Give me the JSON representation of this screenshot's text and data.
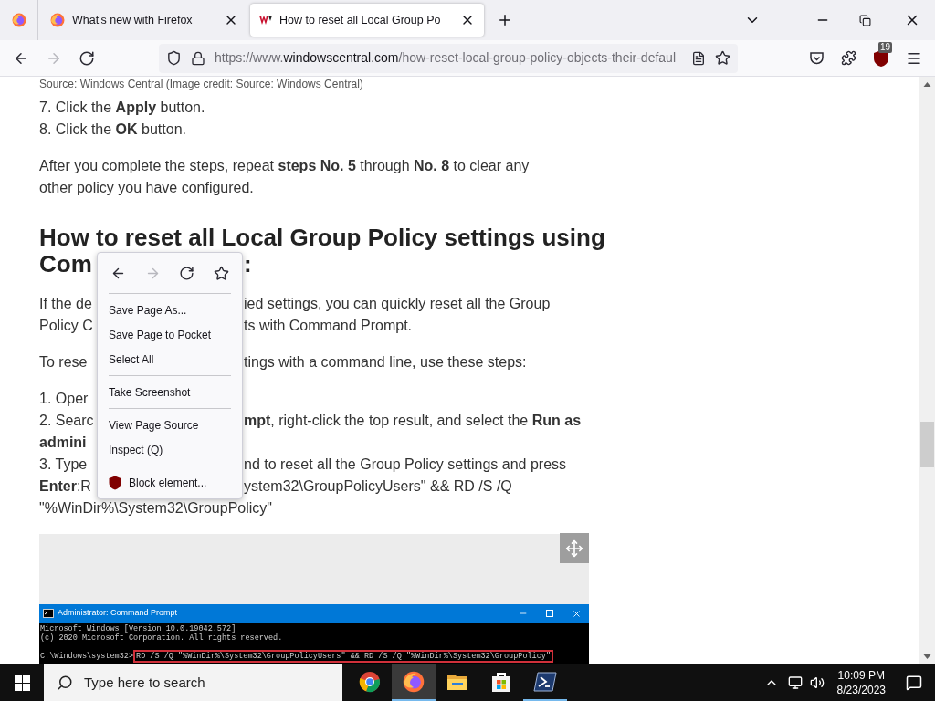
{
  "tabs": [
    {
      "kind": "pinned",
      "selected": false
    },
    {
      "kind": "normal",
      "title": "What's new with Firefox",
      "selected": false
    },
    {
      "kind": "normal",
      "title": "How to reset all Local Group Po",
      "selected": true
    }
  ],
  "nav_buttons": [
    {
      "kind": "back",
      "disabled": false
    },
    {
      "kind": "forward",
      "disabled": true
    },
    {
      "kind": "reload",
      "disabled": false
    }
  ],
  "url": {
    "prefix": "https://www.",
    "domain": "windowscentral.com",
    "path": "/how-reset-local-group-policy-objects-their-defaul"
  },
  "extension_badge": "19",
  "article": {
    "caption": "Source: Windows Central (Image credit: Source: Windows Central)",
    "steps": [
      "7. Click the **Apply** button.",
      "8. Click the **OK** button."
    ],
    "paragraph": "After you complete the steps, repeat **steps No. 5** through **No. 8** to clear any other policy you have configured.",
    "heading_lines": [
      {
        "left": "How to reset all Local Group Policy settings using"
      },
      {
        "left": "Com",
        "right": ":"
      }
    ],
    "lines": [
      {
        "kind": "para",
        "left": "If the de",
        "right": "ied settings, you can quickly reset all the Group"
      },
      {
        "kind": "line",
        "left": "Policy C",
        "right": "ts with Command Prompt."
      },
      {
        "kind": "para",
        "left": "To rese",
        "right": "tings with a command line, use these steps:"
      },
      {
        "kind": "para",
        "left": "1. Oper"
      },
      {
        "kind": "line",
        "left": "2. Searc",
        "right": "**mpt**, right-click the top result, and select the **Run as**"
      },
      {
        "kind": "line",
        "left": "**admini**"
      },
      {
        "kind": "line",
        "left": "3. Type",
        "right": "nd to reset all the Group Policy settings and press"
      },
      {
        "kind": "line",
        "left": "**Enter**:R",
        "right": "ystem32\\GroupPolicyUsers\" && RD /S /Q"
      },
      {
        "kind": "line",
        "left": "\"%WinDir%\\System32\\GroupPolicy\""
      }
    ],
    "console": {
      "title": "Administrator: Command Prompt",
      "lines": [
        "Microsoft Windows [Version 10.0.19042.572]",
        "(c) 2020 Microsoft Corporation. All rights reserved."
      ],
      "prompt": "C:\\Windows\\system32>",
      "command": "RD /S /Q \"%WinDir%\\System32\\GroupPolicyUsers\" && RD /S /Q \"%WinDir%\\System32\\GroupPolicy\""
    }
  },
  "context_menu": {
    "nav": [
      {
        "kind": "back",
        "disabled": false
      },
      {
        "kind": "forward",
        "disabled": true
      },
      {
        "kind": "reload",
        "disabled": false
      },
      {
        "kind": "bookmark",
        "disabled": false
      }
    ],
    "groups": [
      [
        {
          "kind": "item",
          "label": "Save Page As..."
        },
        {
          "kind": "item",
          "label": "Save Page to Pocket"
        },
        {
          "kind": "item",
          "label": "Select All"
        }
      ],
      [
        {
          "kind": "item",
          "label": "Take Screenshot"
        }
      ],
      [
        {
          "kind": "item",
          "label": "View Page Source"
        },
        {
          "kind": "item",
          "label": "Inspect (Q)"
        }
      ],
      [
        {
          "kind": "extension",
          "label": "Block element..."
        }
      ]
    ]
  },
  "taskbar": {
    "search_placeholder": "Type here to search",
    "apps": [
      {
        "kind": "chrome",
        "selected": false,
        "running": false
      },
      {
        "kind": "firefox",
        "selected": true,
        "running": true
      },
      {
        "kind": "explorer",
        "selected": false,
        "running": false
      },
      {
        "kind": "store",
        "selected": false,
        "running": false
      },
      {
        "kind": "terminal",
        "selected": false,
        "running": true
      }
    ],
    "time": "10:09 PM",
    "date": "8/23/2023"
  }
}
